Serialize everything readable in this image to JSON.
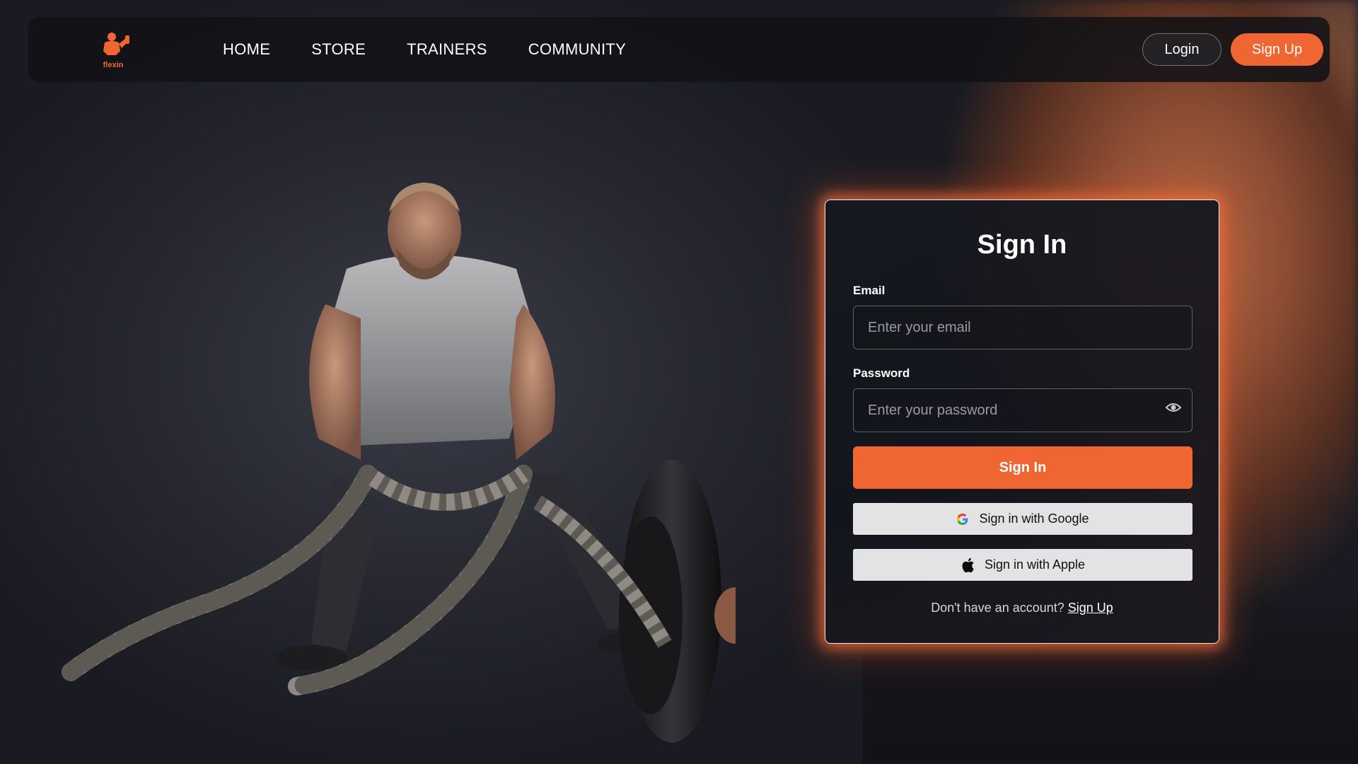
{
  "brand": {
    "name": "flexin",
    "accent": "#ef6633"
  },
  "nav": {
    "links": [
      "HOME",
      "STORE",
      "TRAINERS",
      "COMMUNITY"
    ],
    "login_label": "Login",
    "signup_label": "Sign Up"
  },
  "signin": {
    "title": "Sign In",
    "email_label": "Email",
    "email_placeholder": "Enter your email",
    "password_label": "Password",
    "password_placeholder": "Enter your password",
    "submit_label": "Sign In",
    "google_label": "Sign in with Google",
    "apple_label": "Sign in with Apple",
    "footer_text": "Don't have an account?",
    "footer_link": "Sign Up"
  },
  "icons": {
    "logo": "flexin-logo-icon",
    "password_toggle": "eye-icon",
    "google": "google-icon",
    "apple": "apple-icon"
  }
}
